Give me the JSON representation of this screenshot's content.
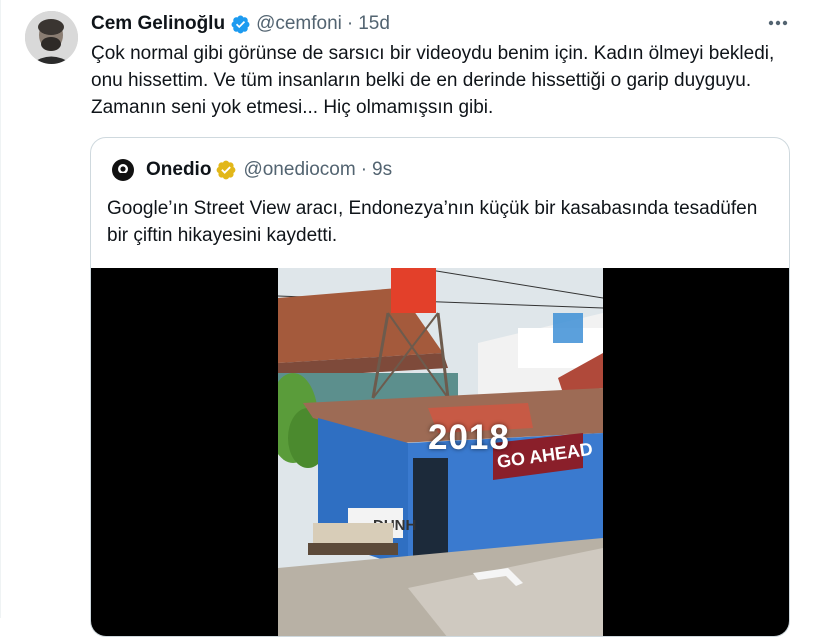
{
  "tweet": {
    "author_name": "Cem Gelinoğlu",
    "handle": "@cemfoni",
    "separator": "·",
    "time": "15d",
    "text": "Çok normal gibi görünse de sarsıcı bir videoydu benim için. Kadın ölmeyi bekledi, onu hissettim. Ve tüm insanların belki de en derinde hissettiği o garip duyguyu. Zamanın seni yok etmesi... Hiç olmamışsın gibi.",
    "icons": {
      "avatar": "avatar-photo",
      "verified": "verified-badge-icon",
      "more": "more-options-icon"
    },
    "colors": {
      "verified": "#1d9bf0",
      "muted": "#536471"
    }
  },
  "quote": {
    "author_name": "Onedio",
    "handle": "@onediocom",
    "separator": "·",
    "time": "9s",
    "text": "Google’ın Street View aracı, Endonezya’nın küçük bir kasabasında tesadüfen bir çiftin hikayesini kaydetti.",
    "icons": {
      "avatar": "onedio-logo-icon",
      "verified": "gold-verified-badge-icon"
    },
    "colors": {
      "verified": "#e2b719"
    },
    "media": {
      "overlay_year": "2018",
      "sign_text": "GO AHEAD",
      "wall_text": "DUNH"
    }
  }
}
